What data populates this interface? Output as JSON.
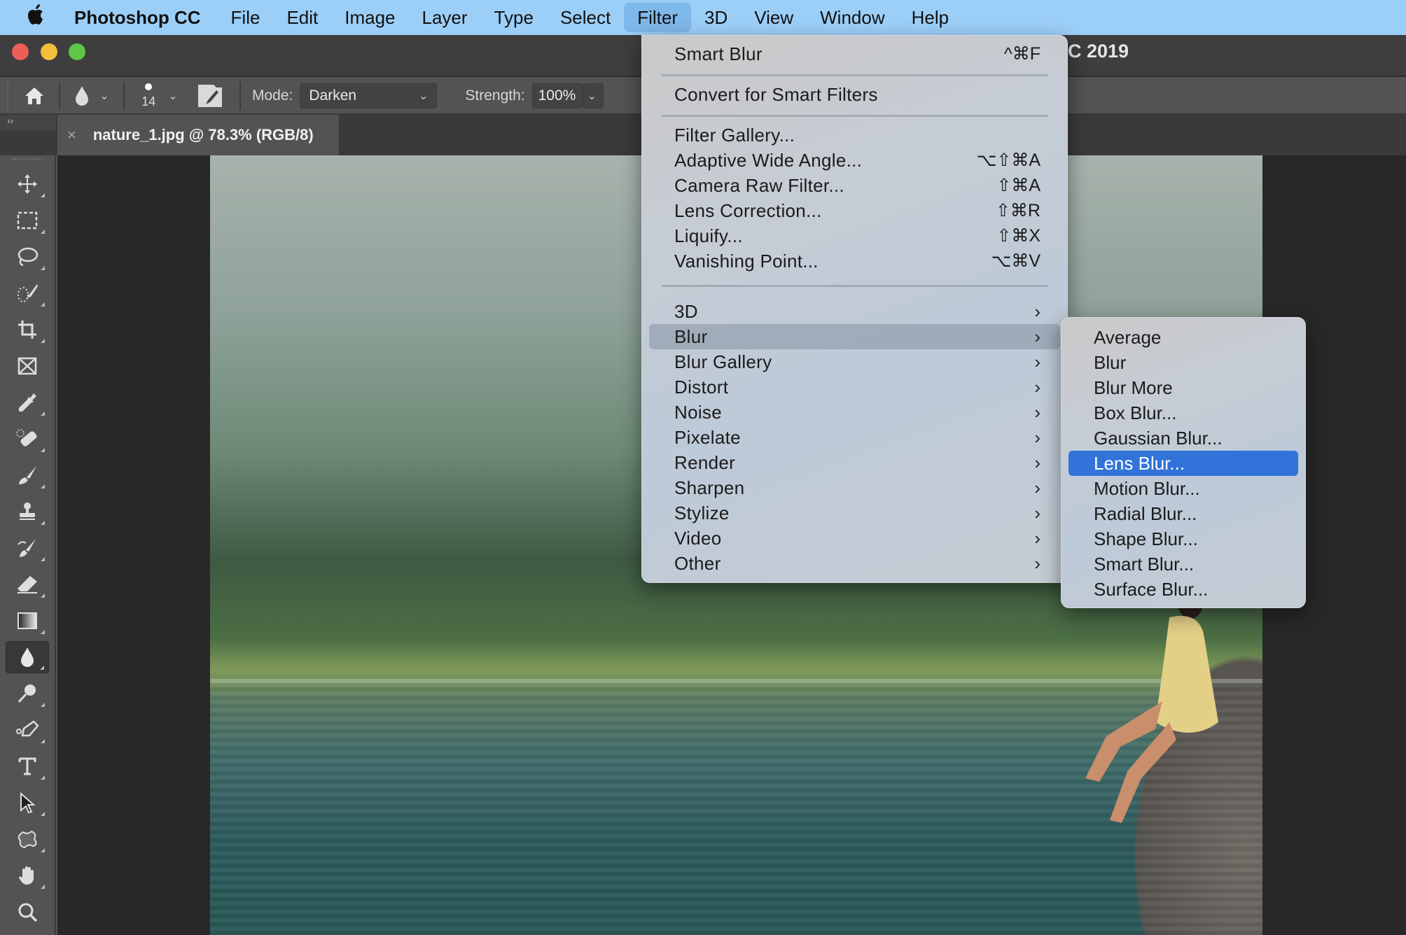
{
  "menubar": {
    "apple_icon": "apple-logo",
    "app_name": "Photoshop CC",
    "items": [
      "File",
      "Edit",
      "Image",
      "Layer",
      "Type",
      "Select",
      "Filter",
      "3D",
      "View",
      "Window",
      "Help"
    ],
    "active": "Filter"
  },
  "window": {
    "title_visible": "C 2019",
    "traffic_lights": {
      "close": "#ee5e57",
      "minimize": "#f4bd3d",
      "zoom": "#5fc646"
    }
  },
  "options_bar": {
    "home_icon": "home-icon",
    "tool_preset_icon": "blur-drop-icon",
    "brush_size": "14",
    "brush_settings_icon": "brush-panel-icon",
    "mode_label": "Mode:",
    "mode_value": "Darken",
    "strength_label": "Strength:",
    "strength_value": "100%"
  },
  "document_tab": {
    "close_glyph": "×",
    "title": "nature_1.jpg @ 78.3% (RGB/8)"
  },
  "panel_toggle": "››",
  "toolbar": {
    "tools": [
      {
        "name": "move-tool",
        "selected": false
      },
      {
        "name": "rectangular-marquee-tool",
        "selected": false
      },
      {
        "name": "lasso-tool",
        "selected": false
      },
      {
        "name": "quick-selection-tool",
        "selected": false
      },
      {
        "name": "crop-tool",
        "selected": false
      },
      {
        "name": "frame-tool",
        "selected": false
      },
      {
        "name": "eyedropper-tool",
        "selected": false
      },
      {
        "name": "spot-healing-brush-tool",
        "selected": false
      },
      {
        "name": "brush-tool",
        "selected": false
      },
      {
        "name": "clone-stamp-tool",
        "selected": false
      },
      {
        "name": "history-brush-tool",
        "selected": false
      },
      {
        "name": "eraser-tool",
        "selected": false
      },
      {
        "name": "gradient-tool",
        "selected": false
      },
      {
        "name": "blur-tool",
        "selected": true
      },
      {
        "name": "dodge-tool",
        "selected": false
      },
      {
        "name": "pen-tool",
        "selected": false
      },
      {
        "name": "type-tool",
        "selected": false
      },
      {
        "name": "path-selection-tool",
        "selected": false
      },
      {
        "name": "custom-shape-tool",
        "selected": false
      },
      {
        "name": "hand-tool",
        "selected": false
      },
      {
        "name": "zoom-tool",
        "selected": false
      }
    ]
  },
  "filter_menu": {
    "top_items": [
      {
        "label": "Smart Blur",
        "shortcut": "^⌘F"
      },
      {
        "label": "Convert for Smart Filters",
        "shortcut": ""
      }
    ],
    "filter_items": [
      {
        "label": "Filter Gallery...",
        "shortcut": ""
      },
      {
        "label": "Adaptive Wide Angle...",
        "shortcut": "⌥⇧⌘A"
      },
      {
        "label": "Camera Raw Filter...",
        "shortcut": "⇧⌘A"
      },
      {
        "label": "Lens Correction...",
        "shortcut": "⇧⌘R"
      },
      {
        "label": "Liquify...",
        "shortcut": "⇧⌘X"
      },
      {
        "label": "Vanishing Point...",
        "shortcut": "⌥⌘V"
      }
    ],
    "submenus": [
      "3D",
      "Blur",
      "Blur Gallery",
      "Distort",
      "Noise",
      "Pixelate",
      "Render",
      "Sharpen",
      "Stylize",
      "Video",
      "Other"
    ],
    "highlighted": "Blur",
    "submenu_arrow": "›"
  },
  "blur_submenu": {
    "items": [
      "Average",
      "Blur",
      "Blur More",
      "Box Blur...",
      "Gaussian Blur...",
      "Lens Blur...",
      "Motion Blur...",
      "Radial Blur...",
      "Shape Blur...",
      "Smart Blur...",
      "Surface Blur..."
    ],
    "selected": "Lens Blur...",
    "selected_color": "#3173d8"
  }
}
